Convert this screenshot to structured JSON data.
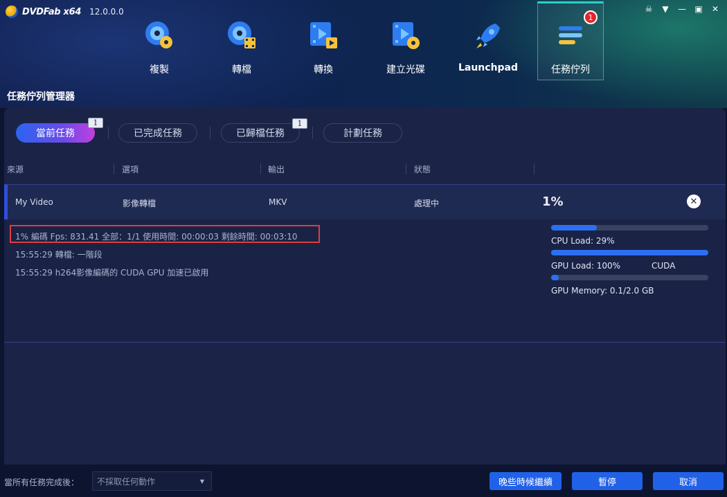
{
  "app": {
    "brand": "DVDFab x64",
    "version": "12.0.0.0"
  },
  "window_controls": [
    "shirt-icon",
    "dropdown-icon",
    "minimize-icon",
    "maximize-icon",
    "close-icon"
  ],
  "nav": [
    {
      "id": "copy",
      "label": "複製",
      "icon": "disc-copy-icon",
      "active": false
    },
    {
      "id": "rip",
      "label": "轉檔",
      "icon": "disc-film-icon",
      "active": false
    },
    {
      "id": "convert",
      "label": "轉換",
      "icon": "video-convert-icon",
      "active": false
    },
    {
      "id": "create",
      "label": "建立光碟",
      "icon": "video-to-disc-icon",
      "active": false
    },
    {
      "id": "launchpad",
      "label": "Launchpad",
      "icon": "rocket-icon",
      "active": false
    },
    {
      "id": "queue",
      "label": "任務佇列",
      "icon": "task-queue-icon",
      "active": true,
      "badge": "1"
    }
  ],
  "page_title": "任務佇列管理器",
  "tabs": [
    {
      "label": "當前任務",
      "badge": "1",
      "active": true
    },
    {
      "label": "已完成任務",
      "badge": "",
      "active": false
    },
    {
      "label": "已歸檔任務",
      "badge": "1",
      "active": false
    },
    {
      "label": "計劃任務",
      "badge": "",
      "active": false
    }
  ],
  "columns": [
    "來源",
    "選項",
    "輸出",
    "狀態"
  ],
  "task": {
    "source": "My Video",
    "option": "影像轉檔",
    "output": "MKV",
    "status": "處理中",
    "percent": "1%"
  },
  "log": [
    "1%  編碼 Fps: 831.41  全部：1/1  使用時間:  00:00:03  剩餘時間:  00:03:10",
    "15:55:29  轉檔: 一階段",
    "15:55:29  h264影像編碼的 CUDA GPU 加速已啟用"
  ],
  "resources": {
    "cpu": {
      "label": "CPU Load: 29%",
      "fill": 0.29
    },
    "gpu": {
      "label": "GPU Load: 100%",
      "tag": "CUDA",
      "fill": 1.0
    },
    "mem": {
      "label": "GPU Memory: 0.1/2.0 GB",
      "fill": 0.05
    }
  },
  "footer": {
    "label": "當所有任務完成後：",
    "select_value": "不採取任何動作",
    "buttons": [
      "晚些時候繼續",
      "暫停",
      "取消"
    ]
  },
  "colors": {
    "accent": "#2161e8",
    "highlight": "#e23c3c",
    "active_tab_start": "#2b64f0",
    "active_tab_end": "#c23fe0"
  }
}
